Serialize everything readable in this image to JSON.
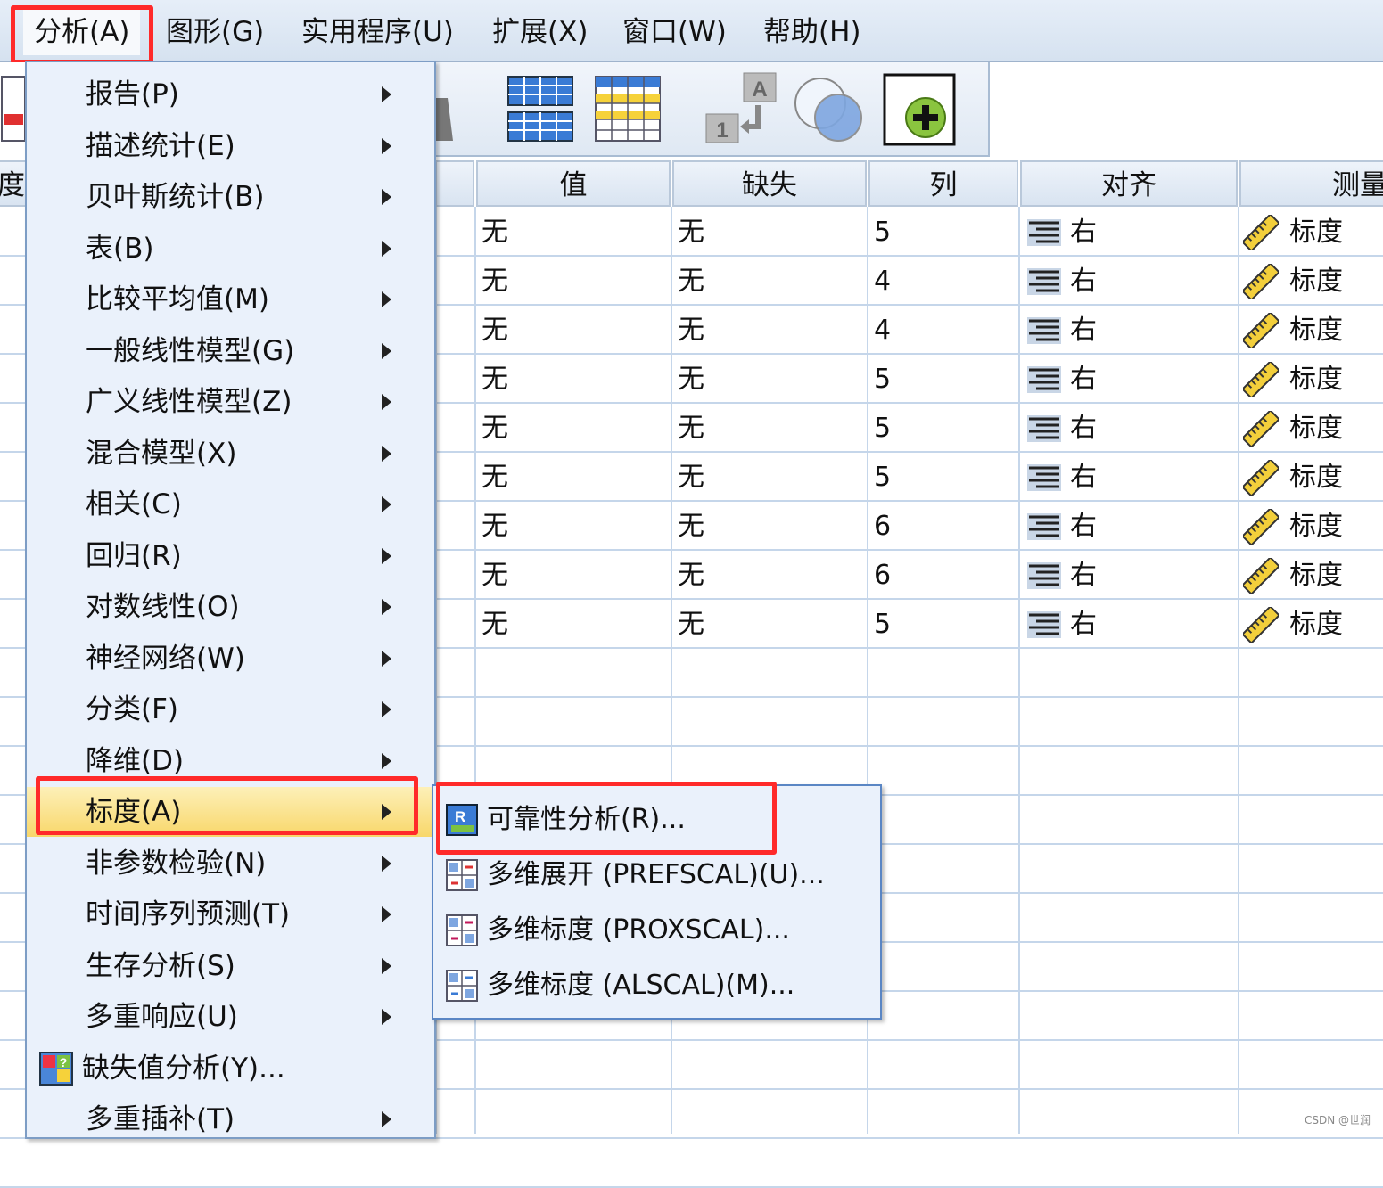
{
  "menubar": {
    "items": [
      "分析(A)",
      "图形(G)",
      "实用程序(U)",
      "扩展(X)",
      "窗口(W)",
      "帮助(H)"
    ]
  },
  "grid": {
    "left_partial_header": "宽度",
    "headers": [
      "值",
      "缺失",
      "列",
      "对齐",
      "测量"
    ],
    "rows": [
      {
        "value": "无",
        "missing": "无",
        "columns": "5",
        "align": "右",
        "measure": "标度"
      },
      {
        "value": "无",
        "missing": "无",
        "columns": "4",
        "align": "右",
        "measure": "标度"
      },
      {
        "value": "无",
        "missing": "无",
        "columns": "4",
        "align": "右",
        "measure": "标度"
      },
      {
        "value": "无",
        "missing": "无",
        "columns": "5",
        "align": "右",
        "measure": "标度"
      },
      {
        "value": "无",
        "missing": "无",
        "columns": "5",
        "align": "右",
        "measure": "标度"
      },
      {
        "value": "无",
        "missing": "无",
        "columns": "5",
        "align": "右",
        "measure": "标度"
      },
      {
        "value": "无",
        "missing": "无",
        "columns": "6",
        "align": "右",
        "measure": "标度"
      },
      {
        "value": "无",
        "missing": "无",
        "columns": "6",
        "align": "右",
        "measure": "标度"
      },
      {
        "value": "无",
        "missing": "无",
        "columns": "5",
        "align": "右",
        "measure": "标度"
      }
    ]
  },
  "analyze_menu": {
    "items": [
      {
        "label": "报告(P)",
        "submenu": true
      },
      {
        "label": "描述统计(E)",
        "submenu": true
      },
      {
        "label": "贝叶斯统计(B)",
        "submenu": true
      },
      {
        "label": "表(B)",
        "submenu": true
      },
      {
        "label": "比较平均值(M)",
        "submenu": true
      },
      {
        "label": "一般线性模型(G)",
        "submenu": true
      },
      {
        "label": "广义线性模型(Z)",
        "submenu": true
      },
      {
        "label": "混合模型(X)",
        "submenu": true
      },
      {
        "label": "相关(C)",
        "submenu": true
      },
      {
        "label": "回归(R)",
        "submenu": true
      },
      {
        "label": "对数线性(O)",
        "submenu": true
      },
      {
        "label": "神经网络(W)",
        "submenu": true
      },
      {
        "label": "分类(F)",
        "submenu": true
      },
      {
        "label": "降维(D)",
        "submenu": true
      },
      {
        "label": "标度(A)",
        "submenu": true,
        "highlighted": true
      },
      {
        "label": "非参数检验(N)",
        "submenu": true
      },
      {
        "label": "时间序列预测(T)",
        "submenu": true
      },
      {
        "label": "生存分析(S)",
        "submenu": true
      },
      {
        "label": "多重响应(U)",
        "submenu": true
      },
      {
        "label": "缺失值分析(Y)...",
        "submenu": false,
        "icon": "missing-value-icon"
      },
      {
        "label": "多重插补(T)",
        "submenu": true
      }
    ]
  },
  "scale_submenu": {
    "items": [
      {
        "label": "可靠性分析(R)...",
        "icon": "reliability-icon"
      },
      {
        "label": "多维展开 (PREFSCAL)(U)...",
        "icon": "prefscal-icon"
      },
      {
        "label": "多维标度 (PROXSCAL)...",
        "icon": "proxscal-icon"
      },
      {
        "label": "多维标度 (ALSCAL)(M)...",
        "icon": "alscal-icon"
      }
    ]
  },
  "colors": {
    "highlight_box": "#ff2a2a",
    "menu_bg": "#eaf1fb",
    "highlight_bg": "#f8d76a"
  },
  "watermark": "CSDN @世润"
}
